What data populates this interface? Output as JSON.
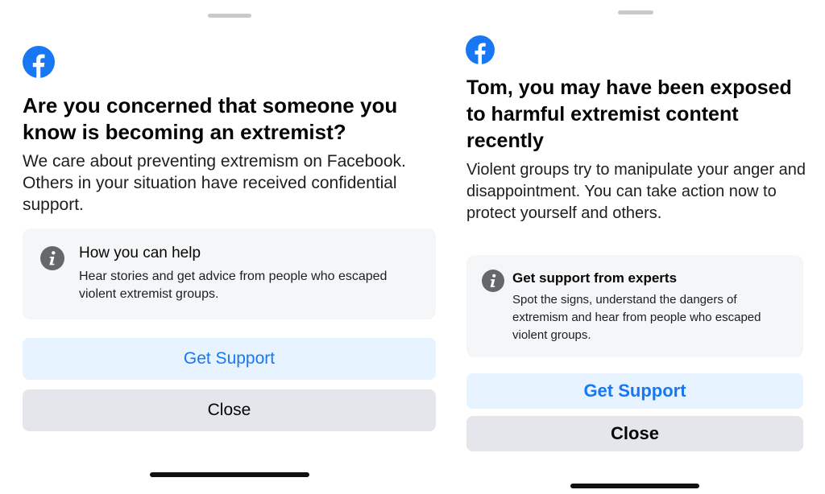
{
  "colors": {
    "facebook_blue": "#1877f2",
    "support_button_bg": "#e7f3ff",
    "close_button_bg": "#e4e6eb",
    "card_bg": "#f5f6f7",
    "info_icon": "#65676b"
  },
  "icons": {
    "logo": "facebook-logo-icon",
    "info": "info-icon"
  },
  "left_screen": {
    "title": "Are you concerned that someone you know is becoming an extremist?",
    "body": "We care about preventing extremism on Facebook. Others in your situation have received confidential support.",
    "card": {
      "title": "How you can help",
      "description": "Hear stories and get advice from people who escaped violent extremist groups."
    },
    "primary_button": "Get Support",
    "secondary_button": "Close"
  },
  "right_screen": {
    "title": "Tom, you may have been exposed to harmful extremist content recently",
    "body": "Violent groups try to manipulate your anger and disappointment. You can take action now to protect yourself and others.",
    "card": {
      "title": "Get support from experts",
      "description": "Spot the signs, understand the dangers of extremism and hear from people who escaped violent groups."
    },
    "primary_button": "Get Support",
    "secondary_button": "Close"
  }
}
